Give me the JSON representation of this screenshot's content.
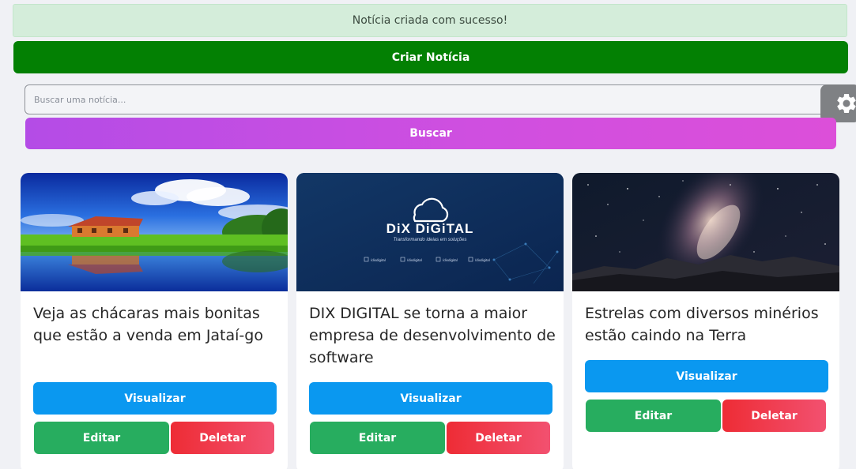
{
  "alert": {
    "message": "Notícia criada com sucesso!"
  },
  "toolbar": {
    "create_label": "Criar Notícia"
  },
  "search": {
    "placeholder": "Buscar uma notícia...",
    "button_label": "Buscar"
  },
  "settings": {
    "icon": "gear-icon"
  },
  "cards": [
    {
      "image": "farm-lake-landscape",
      "title": "Veja as chácaras mais bonitas que estão a venda em Jataí-go",
      "view_label": "Visualizar",
      "edit_label": "Editar",
      "delete_label": "Deletar"
    },
    {
      "image": "dix-digital-logo",
      "image_text": {
        "brand": "DiX DiGiTAL",
        "tagline": "Transformando ideias em soluções",
        "socials": [
          "/dixdigital",
          "/dixdigital",
          "/dixdigital",
          "/dixdigital"
        ]
      },
      "title": "DIX DIGITAL se torna a maior empresa de desenvolvimento de software",
      "view_label": "Visualizar",
      "edit_label": "Editar",
      "delete_label": "Deletar"
    },
    {
      "image": "milky-way-night-sky",
      "title": "Estrelas com diversos minérios estão caindo na Terra",
      "view_label": "Visualizar",
      "edit_label": "Editar",
      "delete_label": "Deletar"
    }
  ],
  "colors": {
    "create": "#038003",
    "search_start": "#b44ce6",
    "search_end": "#dc4fd9",
    "view": "#0a98f0",
    "edit": "#27ad5f",
    "delete": "#ee2c35"
  }
}
